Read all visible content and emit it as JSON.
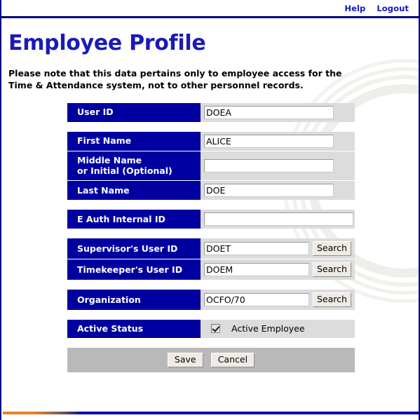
{
  "topbar": {
    "links": [
      {
        "label": "Help",
        "name": "help-link"
      },
      {
        "label": "Logout",
        "name": "logout-link"
      }
    ]
  },
  "page": {
    "title": "Employee Profile",
    "note": "Please note that this data pertains only to employee access for the Time & Attendance system, not to other personnel records."
  },
  "form": {
    "groups": [
      {
        "rows": [
          {
            "label_line1": "User ID",
            "label_line2": "",
            "value": "DOEA",
            "placeholder": "",
            "field_type": "text",
            "width_class": "w-std",
            "has_search": false
          }
        ]
      },
      {
        "rows": [
          {
            "label_line1": "First Name",
            "label_line2": "",
            "value": "ALICE",
            "placeholder": "",
            "field_type": "text",
            "width_class": "w-std",
            "has_search": false
          },
          {
            "label_line1": "Middle Name",
            "label_line2": "or Initial (Optional)",
            "value": "",
            "placeholder": "",
            "field_type": "text",
            "width_class": "w-std",
            "has_search": false
          },
          {
            "label_line1": "Last Name",
            "label_line2": "",
            "value": "DOE",
            "placeholder": "",
            "field_type": "text",
            "width_class": "w-std",
            "has_search": false
          }
        ]
      },
      {
        "rows": [
          {
            "label_line1": "E Auth Internal ID",
            "label_line2": "",
            "value": "",
            "placeholder": "",
            "field_type": "text",
            "width_class": "w-wide",
            "has_search": false
          }
        ]
      },
      {
        "rows": [
          {
            "label_line1": "Supervisor's User ID",
            "label_line2": "",
            "value": "DOET",
            "placeholder": "",
            "field_type": "text",
            "width_class": "w-srch",
            "has_search": true,
            "search_label": "Search"
          },
          {
            "label_line1": "Timekeeper's User ID",
            "label_line2": "",
            "value": "DOEM",
            "placeholder": "",
            "field_type": "text",
            "width_class": "w-srch",
            "has_search": true,
            "search_label": "Search"
          }
        ]
      },
      {
        "rows": [
          {
            "label_line1": "Organization",
            "label_line2": "",
            "value": "OCFO/70",
            "placeholder": "",
            "field_type": "text",
            "width_class": "w-srch",
            "has_search": true,
            "search_label": "Search"
          }
        ]
      },
      {
        "rows": [
          {
            "label_line1": "Active Status",
            "label_line2": "",
            "value": "",
            "field_type": "checkbox",
            "checked": true,
            "checkbox_label": "Active Employee",
            "has_search": false
          }
        ]
      }
    ],
    "actions": {
      "save_label": "Save",
      "cancel_label": "Cancel"
    }
  },
  "colors": {
    "label_navy": "#0000a0",
    "title_blue": "#1a1ab8",
    "link_blue": "#1515cc",
    "row_gray": "#dcdcdc",
    "buttonbar_gray": "#b9b9b9",
    "rule_orange": "#e8822a",
    "rule_navy": "#0000b4"
  }
}
